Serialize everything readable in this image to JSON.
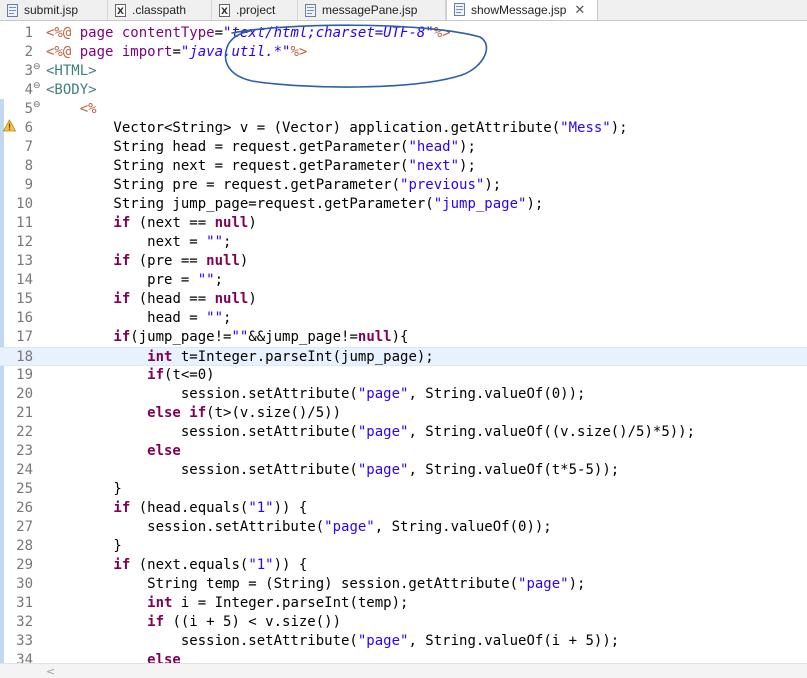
{
  "tabs": [
    {
      "label": "submit.jsp",
      "icon": "jsp-file-icon",
      "active": false
    },
    {
      "label": ".classpath",
      "icon": "xml-file-icon",
      "active": false
    },
    {
      "label": ".project",
      "icon": "xml-file-icon",
      "active": false
    },
    {
      "label": "messagePane.jsp",
      "icon": "jsp-file-icon",
      "active": false
    },
    {
      "label": "showMessage.jsp",
      "icon": "jsp-file-icon",
      "active": true,
      "close": "✕"
    }
  ],
  "editor": {
    "current_line": 18,
    "warning_line": 6,
    "lines": [
      {
        "n": "1",
        "fold": "",
        "segs": [
          [
            "jsp",
            "<%@ "
          ],
          [
            "attr",
            "page "
          ],
          [
            "attr",
            "contentType"
          ],
          [
            "",
            "="
          ],
          [
            "str italic",
            "\"text/html;charset=UTF-8\""
          ],
          [
            "jsp",
            "%>"
          ]
        ]
      },
      {
        "n": "2",
        "fold": "",
        "segs": [
          [
            "jsp",
            "<%@ "
          ],
          [
            "attr",
            "page "
          ],
          [
            "attr",
            "import"
          ],
          [
            "",
            "="
          ],
          [
            "str italic",
            "\"java.util.*\""
          ],
          [
            "jsp",
            "%>"
          ]
        ]
      },
      {
        "n": "3",
        "fold": "⊖",
        "segs": [
          [
            "tag",
            "<HTML>"
          ]
        ]
      },
      {
        "n": "4",
        "fold": "⊖",
        "segs": [
          [
            "tag",
            "<BODY>"
          ]
        ]
      },
      {
        "n": "5",
        "fold": "⊖",
        "segs": [
          [
            "jsp",
            "    <%"
          ]
        ]
      },
      {
        "n": "6",
        "fold": "",
        "segs": [
          [
            "",
            "        Vector<String> v = (Vector) application.getAttribute("
          ],
          [
            "str",
            "\"Mess\""
          ],
          [
            "",
            ");"
          ]
        ]
      },
      {
        "n": "7",
        "fold": "",
        "segs": [
          [
            "",
            "        String head = request.getParameter("
          ],
          [
            "str",
            "\"head\""
          ],
          [
            "",
            ");"
          ]
        ]
      },
      {
        "n": "8",
        "fold": "",
        "segs": [
          [
            "",
            "        String next = request.getParameter("
          ],
          [
            "str",
            "\"next\""
          ],
          [
            "",
            ");"
          ]
        ]
      },
      {
        "n": "9",
        "fold": "",
        "segs": [
          [
            "",
            "        String pre = request.getParameter("
          ],
          [
            "str",
            "\"previous\""
          ],
          [
            "",
            ");"
          ]
        ]
      },
      {
        "n": "10",
        "fold": "",
        "segs": [
          [
            "",
            "        String jump_page=request.getParameter("
          ],
          [
            "str",
            "\"jump_page\""
          ],
          [
            "",
            ");"
          ]
        ]
      },
      {
        "n": "11",
        "fold": "",
        "segs": [
          [
            "kw",
            "        if"
          ],
          [
            "",
            " (next == "
          ],
          [
            "kw",
            "null"
          ],
          [
            "",
            ")"
          ]
        ]
      },
      {
        "n": "12",
        "fold": "",
        "segs": [
          [
            "",
            "            next = "
          ],
          [
            "str",
            "\"\""
          ],
          [
            "",
            ";"
          ]
        ]
      },
      {
        "n": "13",
        "fold": "",
        "segs": [
          [
            "kw",
            "        if"
          ],
          [
            "",
            " (pre == "
          ],
          [
            "kw",
            "null"
          ],
          [
            "",
            ")"
          ]
        ]
      },
      {
        "n": "14",
        "fold": "",
        "segs": [
          [
            "",
            "            pre = "
          ],
          [
            "str",
            "\"\""
          ],
          [
            "",
            ";"
          ]
        ]
      },
      {
        "n": "15",
        "fold": "",
        "segs": [
          [
            "kw",
            "        if"
          ],
          [
            "",
            " (head == "
          ],
          [
            "kw",
            "null"
          ],
          [
            "",
            ")"
          ]
        ]
      },
      {
        "n": "16",
        "fold": "",
        "segs": [
          [
            "",
            "            head = "
          ],
          [
            "str",
            "\"\""
          ],
          [
            "",
            ";"
          ]
        ]
      },
      {
        "n": "17",
        "fold": "",
        "segs": [
          [
            "kw",
            "        if"
          ],
          [
            "",
            "(jump_page!="
          ],
          [
            "str",
            "\"\""
          ],
          [
            "",
            "&&jump_page!="
          ],
          [
            "kw",
            "null"
          ],
          [
            "",
            "){"
          ]
        ]
      },
      {
        "n": "18",
        "fold": "",
        "segs": [
          [
            "kw",
            "            int"
          ],
          [
            "",
            " t=Integer.parseInt(jump_page);"
          ]
        ]
      },
      {
        "n": "19",
        "fold": "",
        "segs": [
          [
            "kw",
            "            if"
          ],
          [
            "",
            "(t<=0)"
          ]
        ]
      },
      {
        "n": "20",
        "fold": "",
        "segs": [
          [
            "",
            "                session.setAttribute("
          ],
          [
            "str",
            "\"page\""
          ],
          [
            "",
            ", String.valueOf(0));"
          ]
        ]
      },
      {
        "n": "21",
        "fold": "",
        "segs": [
          [
            "kw",
            "            else if"
          ],
          [
            "",
            "(t>(v.size()/5))"
          ]
        ]
      },
      {
        "n": "22",
        "fold": "",
        "segs": [
          [
            "",
            "                session.setAttribute("
          ],
          [
            "str",
            "\"page\""
          ],
          [
            "",
            ", String.valueOf((v.size()/5)*5));"
          ]
        ]
      },
      {
        "n": "23",
        "fold": "",
        "segs": [
          [
            "kw",
            "            else"
          ]
        ]
      },
      {
        "n": "24",
        "fold": "",
        "segs": [
          [
            "",
            "                session.setAttribute("
          ],
          [
            "str",
            "\"page\""
          ],
          [
            "",
            ", String.valueOf(t*5-5));"
          ]
        ]
      },
      {
        "n": "25",
        "fold": "",
        "segs": [
          [
            "",
            "        }"
          ]
        ]
      },
      {
        "n": "26",
        "fold": "",
        "segs": [
          [
            "kw",
            "        if"
          ],
          [
            "",
            " (head.equals("
          ],
          [
            "str",
            "\"1\""
          ],
          [
            "",
            ")) {"
          ]
        ]
      },
      {
        "n": "27",
        "fold": "",
        "segs": [
          [
            "",
            "            session.setAttribute("
          ],
          [
            "str",
            "\"page\""
          ],
          [
            "",
            ", String.valueOf(0));"
          ]
        ]
      },
      {
        "n": "28",
        "fold": "",
        "segs": [
          [
            "",
            "        }"
          ]
        ]
      },
      {
        "n": "29",
        "fold": "",
        "segs": [
          [
            "kw",
            "        if"
          ],
          [
            "",
            " (next.equals("
          ],
          [
            "str",
            "\"1\""
          ],
          [
            "",
            ")) {"
          ]
        ]
      },
      {
        "n": "30",
        "fold": "",
        "segs": [
          [
            "",
            "            String temp = (String) session.getAttribute("
          ],
          [
            "str",
            "\"page\""
          ],
          [
            "",
            ");"
          ]
        ]
      },
      {
        "n": "31",
        "fold": "",
        "segs": [
          [
            "kw",
            "            int"
          ],
          [
            "",
            " i = Integer.parseInt(temp);"
          ]
        ]
      },
      {
        "n": "32",
        "fold": "",
        "segs": [
          [
            "kw",
            "            if"
          ],
          [
            "",
            " ((i + 5) < v.size())"
          ]
        ]
      },
      {
        "n": "33",
        "fold": "",
        "segs": [
          [
            "",
            "                session.setAttribute("
          ],
          [
            "str",
            "\"page\""
          ],
          [
            "",
            ", String.valueOf(i + 5));"
          ]
        ]
      },
      {
        "n": "34",
        "fold": "",
        "segs": [
          [
            "kw",
            "            else"
          ]
        ]
      }
    ]
  },
  "scrollbar": {
    "left_arrow": "<"
  }
}
